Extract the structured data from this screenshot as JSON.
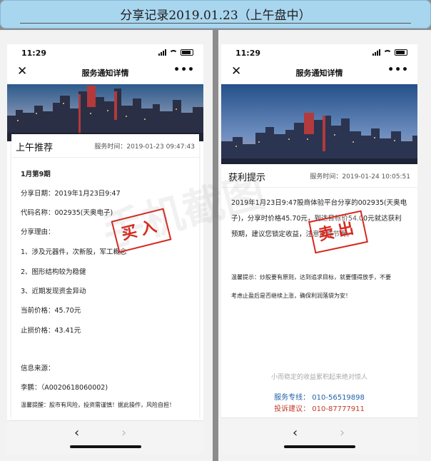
{
  "banner": {
    "title": "分享记录2019.01.23（上午盘中）"
  },
  "watermark": "手机截图",
  "left": {
    "status_time": "11:29",
    "nav_title": "服务通知详情",
    "close_icon": "close-icon",
    "more_icon": "more-icon",
    "card_title": "上午推荐",
    "card_time": "服务时间：2019-01-23 09:47:43",
    "lines": [
      "1月第9期",
      "分享日期：2019年1月23日9:47",
      "代码名称：002935(天奥电子)",
      "分享理由：",
      "1、涉及元器件，次新股，军工概念",
      "2、图形结构较为稳健",
      "3、近期发现资金异动",
      "当前价格：45.70元",
      "止损价格：43.41元",
      "信息来源：",
      "李鹏：（A0020618060002)",
      "温馨提醒：股市有风险，投资需谨慎！据此操作，风险自担！"
    ],
    "stamp": "买入",
    "back_icon": "chevron-left-icon",
    "forward_icon": "chevron-right-icon"
  },
  "right": {
    "status_time": "11:29",
    "nav_title": "服务通知详情",
    "card_title": "获利提示",
    "card_time": "服务时间：2019-01-24 10:05:51",
    "para_lines": [
      "2019年1月23日9:47股商体验平台分享的002935(天奥电",
      "子)，分享时价格45.70元，到达目标价54.00元就达获利",
      "预期，建议您锁定收益，注意把握节奏。"
    ],
    "tip_lines": [
      "温馨提示：炒股要有原则，达到追求目标，就要懂得放手，不要",
      "考虑止盈后是否继续上涨，确保利润落袋为安！"
    ],
    "stamp": "卖出",
    "motto": "小而稳定的收益累积起来绝对惊人",
    "hotline": "服务专线：  010-56519898",
    "complaint": "投诉建议：  010-87777911"
  }
}
